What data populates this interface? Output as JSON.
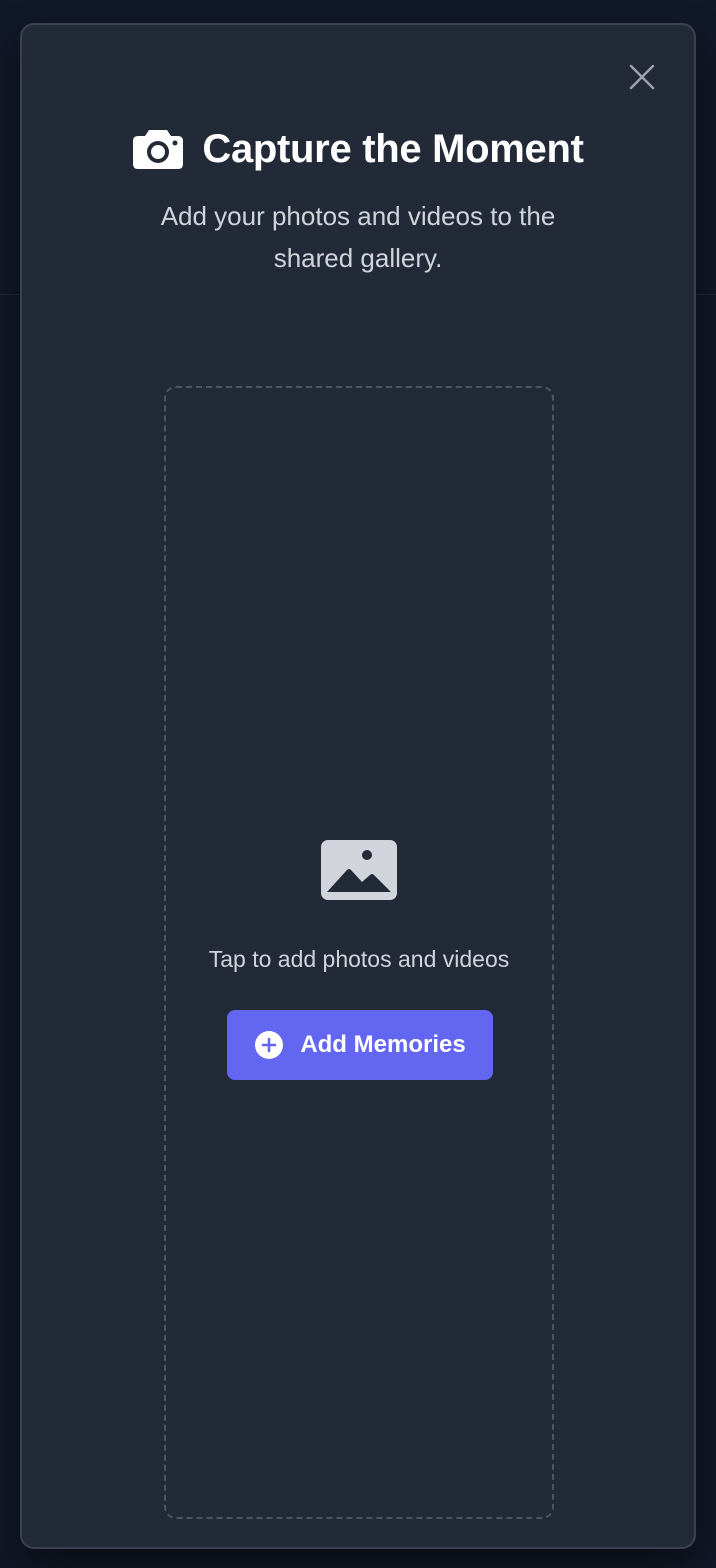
{
  "modal": {
    "title": "Capture the Moment",
    "subtitle": "Add your photos and videos to the shared gallery.",
    "close_icon": "close-icon",
    "title_icon": "camera-icon"
  },
  "dropzone": {
    "icon": "image-icon",
    "hint": "Tap to add photos and videos",
    "button_label": "Add Memories",
    "button_icon": "plus-circle-icon"
  },
  "colors": {
    "page_background": "#111827",
    "modal_background": "#222937",
    "accent": "#6366f1",
    "text_primary": "#ffffff",
    "text_secondary": "#d1d5db"
  }
}
